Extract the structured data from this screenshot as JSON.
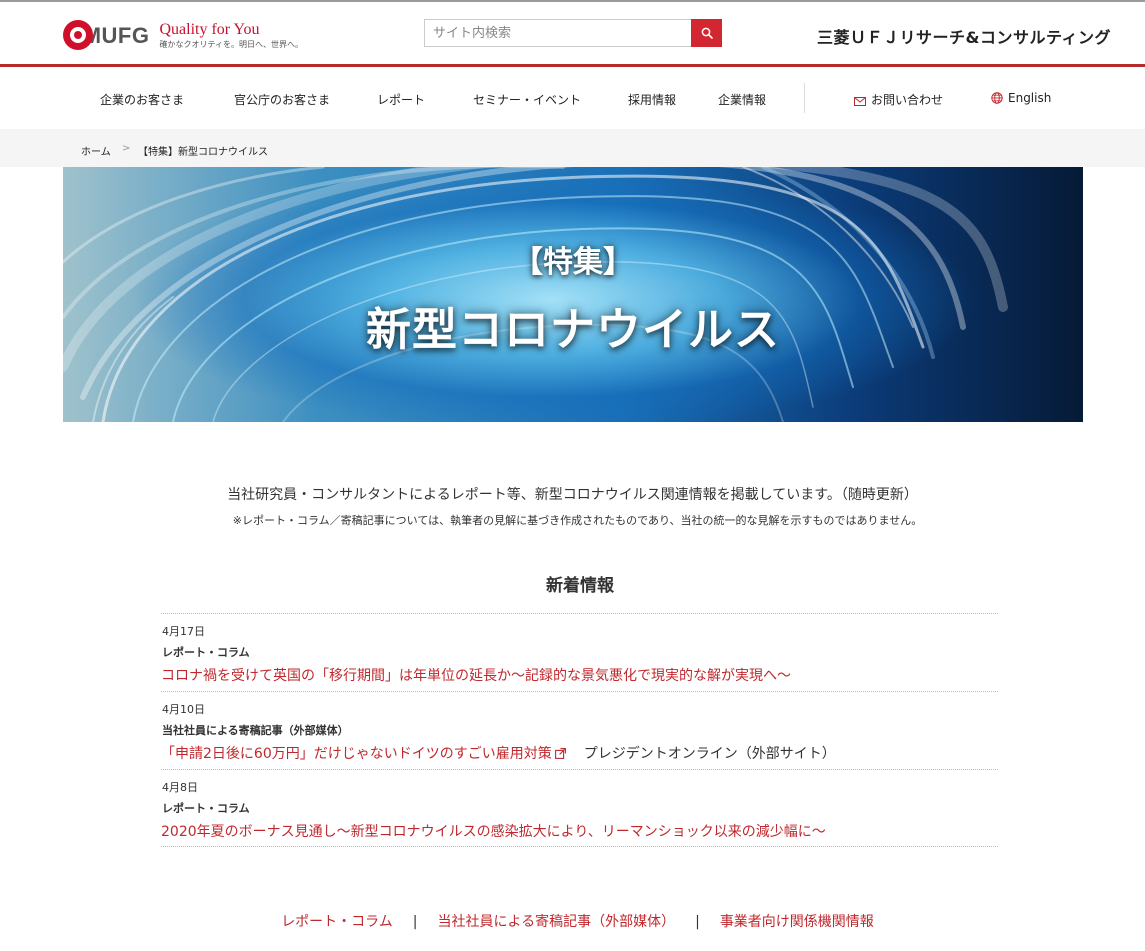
{
  "header": {
    "logo_text": "MUFG",
    "tagline_main": "Quality for You",
    "tagline_sub": "確かなクオリティを。明日へ、世界へ。",
    "search_placeholder": "サイト内検索",
    "brand_name": "三菱ＵＦＪリサーチ&コンサルティング"
  },
  "nav": {
    "items": [
      {
        "label": "企業のお客さま"
      },
      {
        "label": "官公庁のお客さま"
      },
      {
        "label": "レポート"
      },
      {
        "label": "セミナー・イベント"
      },
      {
        "label": "採用情報"
      },
      {
        "label": "企業情報"
      }
    ],
    "contact_label": "お問い合わせ",
    "english_label": "English"
  },
  "breadcrumb": {
    "home": "ホーム",
    "separator": ">",
    "current": "【特集】新型コロナウイルス"
  },
  "hero": {
    "small_title": "【特集】",
    "big_title": "新型コロナウイルス"
  },
  "intro": {
    "main": "当社研究員・コンサルタントによるレポート等、新型コロナウイルス関連情報を掲載しています。（随時更新）",
    "note": "※レポート・コラム／寄稿記事については、執筆者の見解に基づき作成されたものであり、当社の統一的な見解を示すものではありません。"
  },
  "news": {
    "heading": "新着情報",
    "items": [
      {
        "date": "4月17日",
        "category": "レポート・コラム",
        "title": "コロナ禍を受けて英国の「移行期間」は年単位の延長か～記録的な景気悪化で現実的な解が実現へ～",
        "source": ""
      },
      {
        "date": "4月10日",
        "category": "当社社員による寄稿記事（外部媒体）",
        "title": "「申請2日後に60万円」だけじゃないドイツのすごい雇用対策",
        "source": "プレジデントオンライン（外部サイト）"
      },
      {
        "date": "4月8日",
        "category": "レポート・コラム",
        "title": "2020年夏のボーナス見通し～新型コロナウイルスの感染拡大により、リーマンショック以来の減少幅に～",
        "source": ""
      }
    ]
  },
  "bottom_links": {
    "link1": "レポート・コラム",
    "link2": "当社社員による寄稿記事（外部媒体）",
    "link3": "事業者向け関係機関情報",
    "separator": "|"
  },
  "colors": {
    "accent_red": "#c0282d",
    "header_rule": "#b52a2a",
    "search_button": "#d22630"
  }
}
